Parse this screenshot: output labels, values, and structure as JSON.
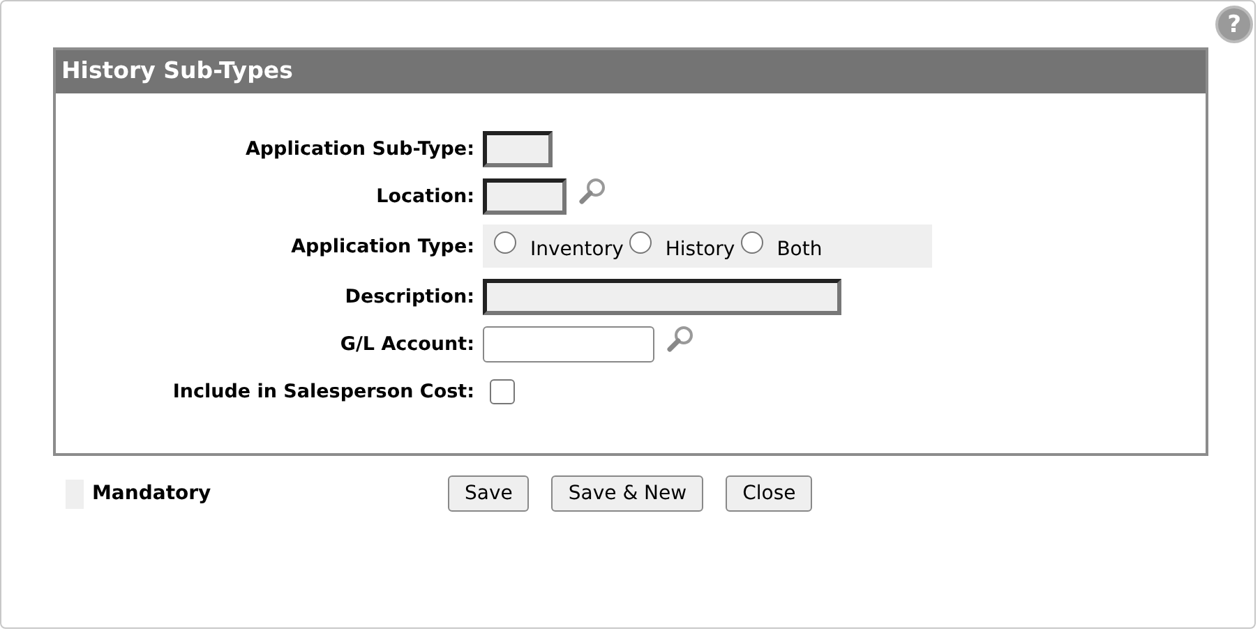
{
  "help_button": {
    "label": "?"
  },
  "panel": {
    "title": "History Sub-Types"
  },
  "fields": [
    {
      "kind": "short",
      "label": "Application Sub-Type:",
      "mandatory": true,
      "lookup": false
    },
    {
      "kind": "medium",
      "label": "Location:",
      "mandatory": true,
      "lookup": true
    },
    {
      "kind": "radio",
      "label": "Application Type:",
      "mandatory": true,
      "options": [
        {
          "label": "Inventory",
          "selected": false
        },
        {
          "label": "History",
          "selected": false
        },
        {
          "label": "Both",
          "selected": false
        }
      ]
    },
    {
      "kind": "wide",
      "label": "Description:",
      "mandatory": true,
      "lookup": false
    },
    {
      "kind": "long",
      "label": "G/L Account:",
      "mandatory": false,
      "lookup": true
    },
    {
      "kind": "checkbox",
      "label": "Include in Salesperson Cost:",
      "checked": false
    }
  ],
  "legend": {
    "label": "Mandatory"
  },
  "buttons": [
    "Save",
    "Save & New",
    "Close"
  ]
}
